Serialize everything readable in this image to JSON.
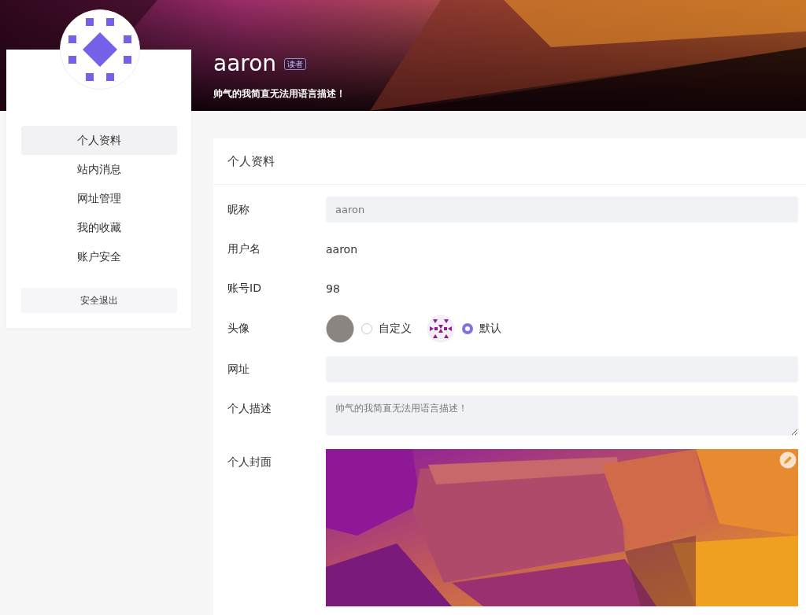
{
  "header": {
    "username": "aaron",
    "role_badge": "读者",
    "bio": "帅气的我简直无法用语言描述！"
  },
  "sidebar": {
    "items": [
      {
        "label": "个人资料",
        "selected": true
      },
      {
        "label": "站内消息",
        "selected": false
      },
      {
        "label": "网址管理",
        "selected": false
      },
      {
        "label": "我的收藏",
        "selected": false
      },
      {
        "label": "账户安全",
        "selected": false
      }
    ],
    "logout_button": "安全退出"
  },
  "panel": {
    "title": "个人资料",
    "fields": [
      {
        "kind": "input",
        "label": "昵称",
        "value": "aaron"
      },
      {
        "kind": "text",
        "label": "用户名",
        "value": "aaron"
      },
      {
        "kind": "text",
        "label": "账号ID",
        "value": "98"
      },
      {
        "kind": "avatar",
        "label": "头像",
        "options": [
          {
            "kind": "plain",
            "label": "自定义",
            "selected": false
          },
          {
            "kind": "pattern",
            "label": "默认",
            "selected": true
          }
        ]
      },
      {
        "kind": "input",
        "label": "网址"
      },
      {
        "kind": "textarea",
        "label": "个人描述",
        "value": "帅气的我简直无法用语言描述！"
      },
      {
        "kind": "cover",
        "label": "个人封面"
      }
    ]
  }
}
